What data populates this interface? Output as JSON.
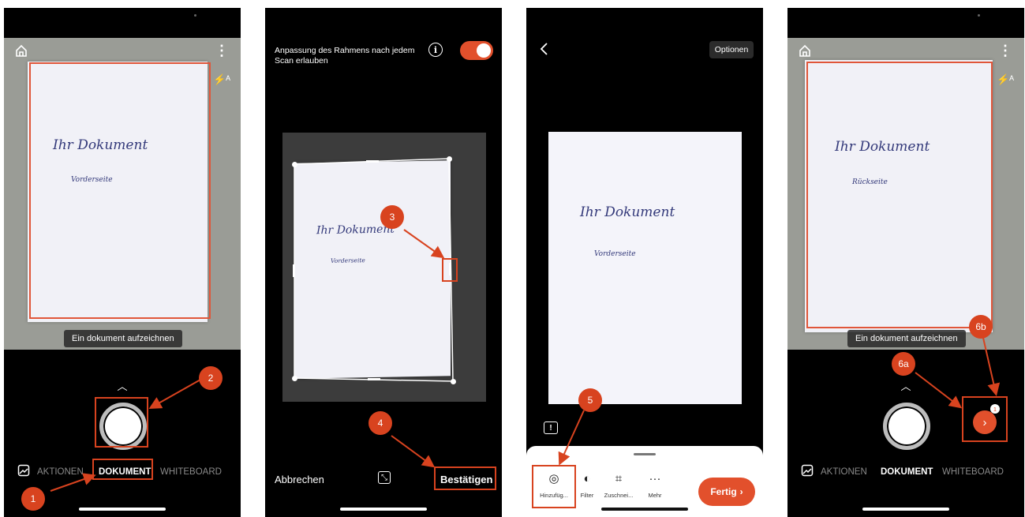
{
  "phone1": {
    "paper_title": "Ihr Dokument",
    "paper_sub": "Vorderseite",
    "hint": "Ein dokument aufzeichnen",
    "modes": [
      "AKTIONEN",
      "DOKUMENT",
      "WHITEBOARD"
    ],
    "badges": [
      "1",
      "2"
    ]
  },
  "phone2": {
    "toggle_text": "Anpassung des Rahmens nach jedem Scan erlauben",
    "toggle_on": true,
    "paper_title": "Ihr Dokument",
    "paper_sub": "Vorderseite",
    "cancel_label": "Abbrechen",
    "confirm_label": "Bestätigen",
    "badges": [
      "3",
      "4"
    ]
  },
  "phone3": {
    "options_label": "Optionen",
    "paper_title": "Ihr Dokument",
    "paper_sub": "Vorderseite",
    "tools": [
      {
        "icon": "add-camera-icon",
        "label": "Hinzufüg..."
      },
      {
        "icon": "filter-icon",
        "label": "Filter"
      },
      {
        "icon": "crop-icon",
        "label": "Zuschnei..."
      },
      {
        "icon": "more-icon",
        "label": "Mehr"
      }
    ],
    "done_label": "Fertig",
    "badges": [
      "5"
    ]
  },
  "phone4": {
    "paper_title": "Ihr Dokument",
    "paper_sub": "Rückseite",
    "hint": "Ein dokument aufzeichnen",
    "modes": [
      "AKTIONEN",
      "DOKUMENT",
      "WHITEBOARD"
    ],
    "page_count": "1",
    "badges": [
      "6a",
      "6b"
    ]
  },
  "colors": {
    "accent": "#e2502c",
    "callout": "#d8431f"
  }
}
